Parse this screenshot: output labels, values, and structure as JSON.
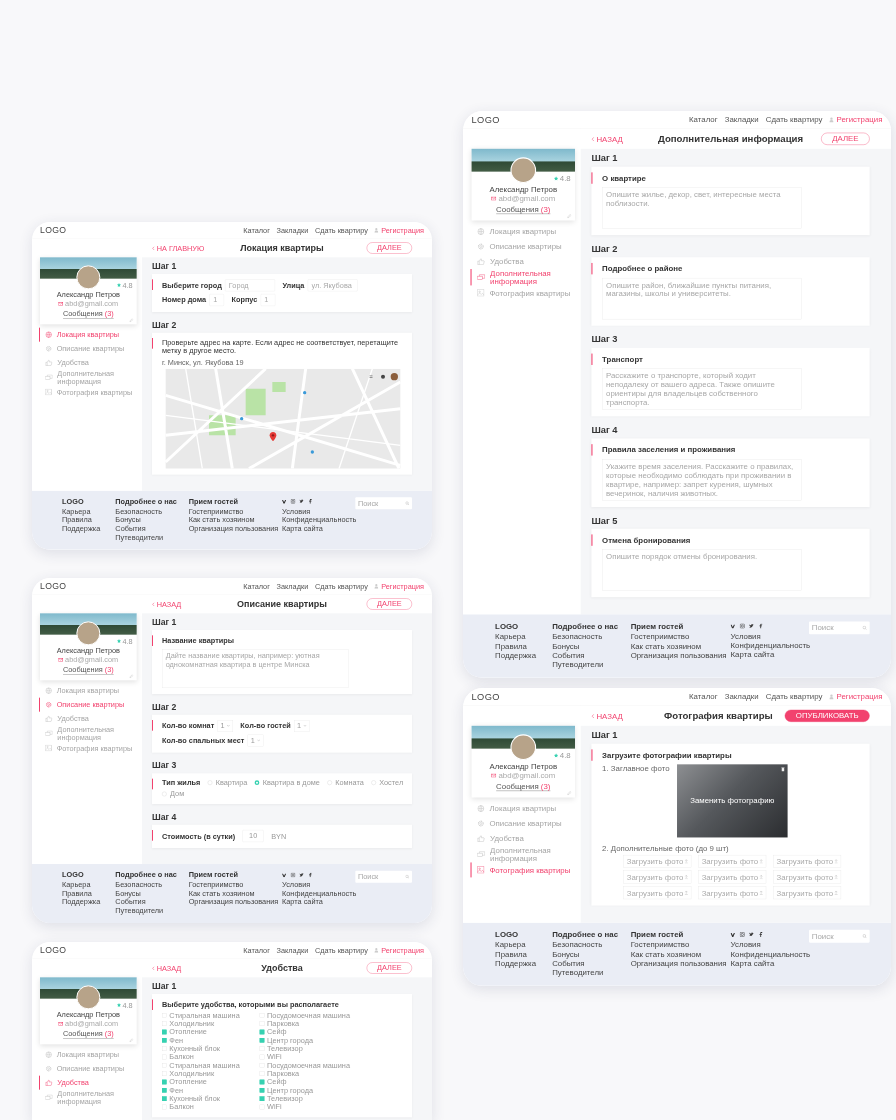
{
  "screens": [
    {
      "header": {
        "logo": "LOGO",
        "nav": [
          "Каталог",
          "Закладки",
          "Сдать квартиру"
        ],
        "register": "Регистрация"
      },
      "back": "НА ГЛАВНУЮ",
      "title": "Локация квартиры",
      "action": {
        "label": "ДАЛЕЕ",
        "kind": "outline"
      },
      "profile": {
        "rating": "4.8",
        "name": "Александр Петров",
        "email": "abd@gmail.com",
        "messages": "Сообщения",
        "message_count": "(3)"
      },
      "menu": [
        {
          "label": "Локация квартиры",
          "selected": true
        },
        {
          "label": "Описание квартиры",
          "selected": false
        },
        {
          "label": "Удобства",
          "selected": false
        },
        {
          "label": "Дополнительная информация",
          "selected": false
        },
        {
          "label": "Фотография квартиры",
          "selected": false
        }
      ],
      "steps": [
        {
          "title": "Шаг 1",
          "kind": "address",
          "fields": [
            {
              "label": "Выберите город",
              "placeholder": "Город"
            },
            {
              "label": "Улица",
              "placeholder": "ул. Якубова"
            },
            {
              "label": "Номер дома",
              "placeholder": "1"
            },
            {
              "label": "Корпус",
              "placeholder": "1"
            }
          ]
        },
        {
          "title": "Шаг 2",
          "kind": "map",
          "label": "Проверьте адрес на карте. Если адрес не соответствует, перетащите метку в другое место.",
          "address": "г. Минск, ул. Якубова 19"
        }
      ],
      "footer": {
        "columns": [
          {
            "kind": "text",
            "heading": "LOGO",
            "links": [
              "Карьера",
              "Правила",
              "Поддержка"
            ]
          },
          {
            "kind": "text",
            "heading": "Подробнее о нас",
            "links": [
              "Безопасность",
              "Бонусы",
              "События",
              "Путеводители"
            ]
          },
          {
            "kind": "text",
            "heading": "Прием гостей",
            "links": [
              "Гостеприимство",
              "Как стать хозяином",
              "Организация пользования"
            ]
          },
          {
            "kind": "social",
            "links": [
              "Условия",
              "Конфиденциальность",
              "Карта сайта"
            ]
          }
        ],
        "search_placeholder": "Поиск"
      }
    },
    {
      "header": {
        "logo": "LOGO",
        "nav": [
          "Каталог",
          "Закладки",
          "Сдать квартиру"
        ],
        "register": "Регистрация"
      },
      "back": "НАЗАД",
      "title": "Описание квартиры",
      "action": {
        "label": "ДАЛЕЕ",
        "kind": "outline"
      },
      "profile": {
        "rating": "4.8",
        "name": "Александр Петров",
        "email": "abd@gmail.com",
        "messages": "Сообщения",
        "message_count": "(3)"
      },
      "menu": [
        {
          "label": "Локация квартиры",
          "selected": false
        },
        {
          "label": "Описание квартиры",
          "selected": true
        },
        {
          "label": "Удобства",
          "selected": false
        },
        {
          "label": "Дополнительная информация",
          "selected": false
        },
        {
          "label": "Фотография квартиры",
          "selected": false
        }
      ],
      "steps": [
        {
          "title": "Шаг 1",
          "kind": "textarea",
          "label": "Название квартиры",
          "placeholder": "Дайте название квартиры, например: уютная однокомнатная квартира в центре Минска"
        },
        {
          "title": "Шаг 2",
          "kind": "selects",
          "items": [
            {
              "label": "Кол-во комнат",
              "value": "1"
            },
            {
              "label": "Кол-во гостей",
              "value": "1"
            },
            {
              "label": "Кол-во спальных мест",
              "value": "1"
            }
          ]
        },
        {
          "title": "Шаг 3",
          "kind": "radios",
          "label": "Тип жилья",
          "options": [
            {
              "label": "Квартира",
              "selected": false
            },
            {
              "label": "Квартира в доме",
              "selected": true
            },
            {
              "label": "Комната",
              "selected": false
            },
            {
              "label": "Хостел",
              "selected": false
            },
            {
              "label": "Дом",
              "selected": false
            }
          ]
        },
        {
          "title": "Шаг 4",
          "kind": "price",
          "label": "Стоимость (в сутки)",
          "value": "10",
          "unit": "BYN"
        }
      ],
      "footer": {
        "columns": [
          {
            "kind": "text",
            "heading": "LOGO",
            "links": [
              "Карьера",
              "Правила",
              "Поддержка"
            ]
          },
          {
            "kind": "text",
            "heading": "Подробнее о нас",
            "links": [
              "Безопасность",
              "Бонусы",
              "События",
              "Путеводители"
            ]
          },
          {
            "kind": "text",
            "heading": "Прием гостей",
            "links": [
              "Гостеприимство",
              "Как стать хозяином",
              "Организация пользования"
            ]
          },
          {
            "kind": "social",
            "links": [
              "Условия",
              "Конфиденциальность",
              "Карта сайта"
            ]
          }
        ],
        "search_placeholder": "Поиск"
      }
    },
    {
      "header": {
        "logo": "LOGO",
        "nav": [
          "Каталог",
          "Закладки",
          "Сдать квартиру"
        ],
        "register": "Регистрация"
      },
      "back": "НАЗАД",
      "title": "Удобства",
      "action": {
        "label": "ДАЛЕЕ",
        "kind": "outline"
      },
      "profile": {
        "rating": "4.8",
        "name": "Александр Петров",
        "email": "abd@gmail.com",
        "messages": "Сообщения",
        "message_count": "(3)"
      },
      "menu": [
        {
          "label": "Локация квартиры",
          "selected": false
        },
        {
          "label": "Описание квартиры",
          "selected": false
        },
        {
          "label": "Удобства",
          "selected": true
        },
        {
          "label": "Дополнительная информация",
          "selected": false
        }
      ],
      "steps": [
        {
          "title": "Шаг 1",
          "kind": "checkboxes",
          "label": "Выберите удобства, которыми вы располагаете",
          "columns": [
            [
              {
                "label": "Стиральная машина",
                "checked": false
              },
              {
                "label": "Холодильник",
                "checked": false
              },
              {
                "label": "Отопление",
                "checked": true
              },
              {
                "label": "Фен",
                "checked": true
              },
              {
                "label": "Кухонный блок",
                "checked": false
              },
              {
                "label": "Балкон",
                "checked": false
              },
              {
                "label": "Стиральная машина",
                "checked": false
              },
              {
                "label": "Холодильник",
                "checked": false
              },
              {
                "label": "Отопление",
                "checked": true
              },
              {
                "label": "Фен",
                "checked": true
              },
              {
                "label": "Кухонный блок",
                "checked": true
              },
              {
                "label": "Балкон",
                "checked": false
              }
            ],
            [
              {
                "label": "Посудомоечная машина",
                "checked": false
              },
              {
                "label": "Парковка",
                "checked": false
              },
              {
                "label": "Сейф",
                "checked": true
              },
              {
                "label": "Центр города",
                "checked": true
              },
              {
                "label": "Телевизор",
                "checked": false
              },
              {
                "label": "WiFi",
                "checked": false
              },
              {
                "label": "Посудомоечная машина",
                "checked": false
              },
              {
                "label": "Парковка",
                "checked": false
              },
              {
                "label": "Сейф",
                "checked": true
              },
              {
                "label": "Центр города",
                "checked": true
              },
              {
                "label": "Телевизор",
                "checked": true
              },
              {
                "label": "WiFi",
                "checked": false
              }
            ]
          ]
        }
      ]
    },
    {
      "header": {
        "logo": "LOGO",
        "nav": [
          "Каталог",
          "Закладки",
          "Сдать квартиру"
        ],
        "register": "Регистрация"
      },
      "back": "НАЗАД",
      "title": "Дополнительная информация",
      "action": {
        "label": "ДАЛЕЕ",
        "kind": "outline"
      },
      "profile": {
        "rating": "4.8",
        "name": "Александр Петров",
        "email": "abd@gmail.com",
        "messages": "Сообщения",
        "message_count": "(3)"
      },
      "menu": [
        {
          "label": "Локация квартиры",
          "selected": false
        },
        {
          "label": "Описание квартиры",
          "selected": false
        },
        {
          "label": "Удобства",
          "selected": false
        },
        {
          "label": "Дополнительная информация",
          "selected": true
        },
        {
          "label": "Фотография квартиры",
          "selected": false
        }
      ],
      "steps": [
        {
          "title": "Шаг 1",
          "kind": "textarea",
          "label": "О квартире",
          "placeholder": "Опишите жилье, декор, свет, интересные места поблизости."
        },
        {
          "title": "Шаг 2",
          "kind": "textarea",
          "label": "Подробнее о районе",
          "placeholder": "Опишите район, ближайшие пункты питания, магазины, школы и университеты."
        },
        {
          "title": "Шаг 3",
          "kind": "textarea",
          "label": "Транспорт",
          "placeholder": "Расскажите о транспорте, который ходит неподалеку от вашего адреса. Также опишите ориентиры для владельцев собственного транспорта."
        },
        {
          "title": "Шаг 4",
          "kind": "textarea",
          "label": "Правила заселения и проживания",
          "placeholder": "Укажите время заселения. Расскажите о правилах, которые необходимо соблюдать при проживании в квартире, например: запрет курения, шумных вечеринок, наличия животных."
        },
        {
          "title": "Шаг 5",
          "kind": "textarea",
          "label": "Отмена бронирования",
          "placeholder": "Опишите порядок отмены бронирования."
        }
      ],
      "footer": {
        "columns": [
          {
            "kind": "text",
            "heading": "LOGO",
            "links": [
              "Карьера",
              "Правила",
              "Поддержка"
            ]
          },
          {
            "kind": "text",
            "heading": "Подробнее о нас",
            "links": [
              "Безопасность",
              "Бонусы",
              "События",
              "Путеводители"
            ]
          },
          {
            "kind": "text",
            "heading": "Прием гостей",
            "links": [
              "Гостеприимство",
              "Как стать хозяином",
              "Организация пользования"
            ]
          },
          {
            "kind": "social",
            "links": [
              "Условия",
              "Конфиденциальность",
              "Карта сайта"
            ]
          }
        ],
        "search_placeholder": "Поиск"
      }
    },
    {
      "header": {
        "logo": "LOGO",
        "nav": [
          "Каталог",
          "Закладки",
          "Сдать квартиру"
        ],
        "register": "Регистрация"
      },
      "back": "НАЗАД",
      "title": "Фотография квартиры",
      "action": {
        "label": "ОПУБЛИКОВАТЬ",
        "kind": "filled"
      },
      "profile": {
        "rating": "4.8",
        "name": "Александр Петров",
        "email": "abd@gmail.com",
        "messages": "Сообщения",
        "message_count": "(3)"
      },
      "menu": [
        {
          "label": "Локация квартиры",
          "selected": false
        },
        {
          "label": "Описание квартиры",
          "selected": false
        },
        {
          "label": "Удобства",
          "selected": false
        },
        {
          "label": "Дополнительная информация",
          "selected": false
        },
        {
          "label": "Фотография квартиры",
          "selected": true
        }
      ],
      "steps": [
        {
          "title": "Шаг 1",
          "kind": "photos",
          "label": "Загрузите фотографии квартиры",
          "main_label": "1. Заглавное фото",
          "replace": "Заменить фотографию",
          "extra_label": "2. Дополнительные фото (до 9 шт)",
          "uploads": [
            "Загрузить фото",
            "Загрузить фото",
            "Загрузить фото",
            "Загрузить фото",
            "Загрузить фото",
            "Загрузить фото",
            "Загрузить фото",
            "Загрузить фото",
            "Загрузить фото"
          ]
        }
      ],
      "footer": {
        "columns": [
          {
            "kind": "text",
            "heading": "LOGO",
            "links": [
              "Карьера",
              "Правила",
              "Поддержка"
            ]
          },
          {
            "kind": "text",
            "heading": "Подробнее о нас",
            "links": [
              "Безопасность",
              "Бонусы",
              "События",
              "Путеводители"
            ]
          },
          {
            "kind": "text",
            "heading": "Прием гостей",
            "links": [
              "Гостеприимство",
              "Как стать хозяином",
              "Организация пользования"
            ]
          },
          {
            "kind": "social",
            "links": [
              "Условия",
              "Конфиденциальность",
              "Карта сайта"
            ]
          }
        ],
        "search_placeholder": "Поиск"
      }
    }
  ]
}
